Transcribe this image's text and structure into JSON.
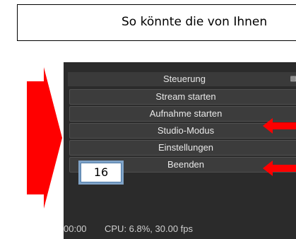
{
  "banner": {
    "text": "So könnte die von Ihnen"
  },
  "obs": {
    "header": "Steuerung",
    "dock_icon": "dock-float-icon",
    "buttons": [
      {
        "label": "Stream starten"
      },
      {
        "label": "Aufnahme starten"
      },
      {
        "label": "Studio-Modus"
      },
      {
        "label": "Einstellungen"
      },
      {
        "label": "Beenden"
      }
    ],
    "status": {
      "time": "00:00",
      "cpu": "CPU: 6.8%, 30.00 fps"
    }
  },
  "badge": {
    "number": "16"
  },
  "colors": {
    "arrow": "#ff0000",
    "panel_bg": "#2b2b2b",
    "button_bg": "#3c3c3c",
    "badge_border": "#7fa3c7"
  }
}
